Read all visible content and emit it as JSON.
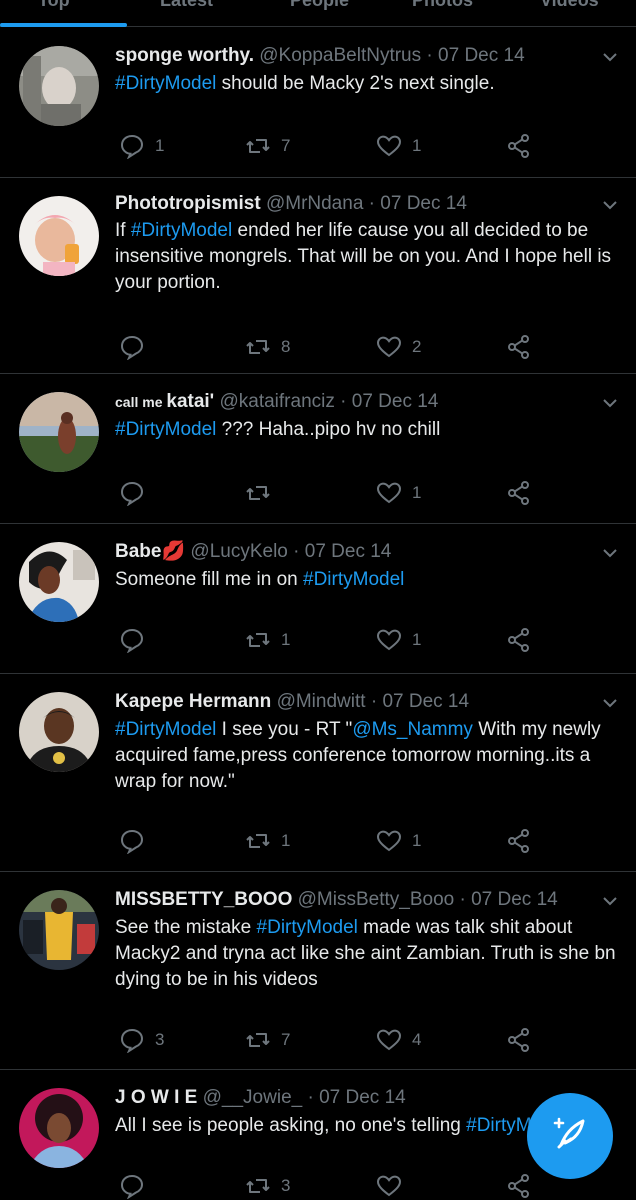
{
  "tabs": [
    "Top",
    "Latest",
    "People",
    "Photos",
    "Videos"
  ],
  "accent": "#1d9bf0",
  "tweets": [
    {
      "name": "sponge worthy.",
      "handle": "@KoppaBeltNytrus",
      "sep": "·",
      "date": "07 Dec 14",
      "segments": [
        {
          "text": "#DirtyModel",
          "tag": true
        },
        {
          "text": " should be Macky 2's next single."
        }
      ],
      "replies": "1",
      "retweets": "7",
      "likes": "1"
    },
    {
      "name": "Phototropismist",
      "handle": "@MrNdana",
      "sep": "·",
      "date": "07 Dec 14",
      "segments": [
        {
          "text": "If "
        },
        {
          "text": "#DirtyModel",
          "tag": true
        },
        {
          "text": " ended her life cause you all decided to be insensitive mongrels. That will be on you. And I hope hell is your portion."
        }
      ],
      "replies": "",
      "retweets": "8",
      "likes": "2"
    },
    {
      "name_prefix": "call me ",
      "name": "katai'",
      "handle": "@kataifranciz",
      "sep": "·",
      "date": "07 Dec 14",
      "segments": [
        {
          "text": "#DirtyModel",
          "tag": true
        },
        {
          "text": " ??? Haha..pipo hv no chill"
        }
      ],
      "replies": "",
      "retweets": "",
      "likes": "1"
    },
    {
      "name": "Babe💋",
      "handle": "@LucyKelo",
      "sep": "·",
      "date": "07 Dec 14",
      "segments": [
        {
          "text": "Someone fill me in on "
        },
        {
          "text": "#DirtyModel",
          "tag": true
        }
      ],
      "replies": "",
      "retweets": "1",
      "likes": "1"
    },
    {
      "name": "Kapepe Hermann",
      "handle": "@Mindwitt",
      "sep": "·",
      "date": "07 Dec 14",
      "segments": [
        {
          "text": "#DirtyModel",
          "tag": true
        },
        {
          "text": " I see you  -  RT \""
        },
        {
          "text": "@Ms_Nammy",
          "tag": true
        },
        {
          "text": " With my newly acquired fame,press conference tomorrow morning..its a wrap for now.\""
        }
      ],
      "replies": "",
      "retweets": "1",
      "likes": "1"
    },
    {
      "name": "MISSBETTY_BOOO",
      "handle": "@MissBetty_Booo",
      "sep": "·",
      "date": "07 Dec 14",
      "segments": [
        {
          "text": "See the mistake "
        },
        {
          "text": "#DirtyModel",
          "tag": true
        },
        {
          "text": " made was talk shit about Macky2 and tryna act like she aint Zambian. Truth is she bn dying to be in his videos"
        }
      ],
      "replies": "3",
      "retweets": "7",
      "likes": "4"
    },
    {
      "name": "J O W I E",
      "handle": "@__Jowie_",
      "sep": "·",
      "date": "07 Dec 14",
      "segments": [
        {
          "text": "All I see is people asking, no one's telling "
        },
        {
          "text": "#DirtyModel",
          "tag": true
        }
      ],
      "replies": "",
      "retweets": "3",
      "likes": ""
    }
  ],
  "fab": {
    "icon": "compose-quill-icon"
  }
}
